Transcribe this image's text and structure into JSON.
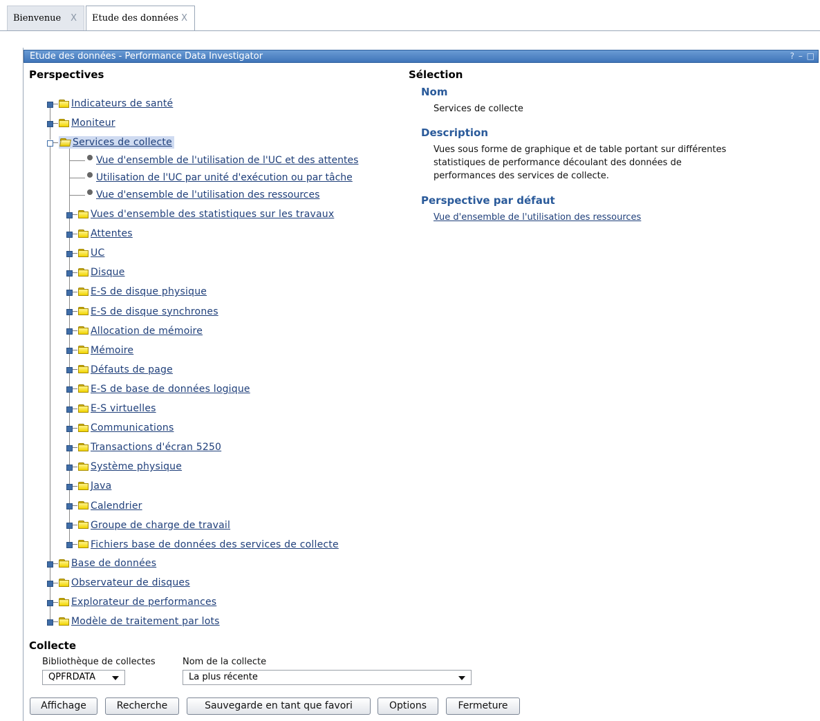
{
  "tabs": [
    {
      "label": "Bienvenue",
      "close": "X"
    },
    {
      "label": "Etude des données",
      "close": "X"
    }
  ],
  "panel": {
    "title": "Etude des données - Performance Data Investigator",
    "controls": "? – □"
  },
  "perspectives": {
    "heading": "Perspectives",
    "top_items": [
      "Indicateurs de santé",
      "Moniteur",
      "Services de collecte"
    ],
    "collection_views": [
      "Vue d'ensemble de l'utilisation de l'UC et des attentes",
      "Utilisation de l'UC par unité d'exécution ou par tâche",
      "Vue d'ensemble de l'utilisation des ressources"
    ],
    "collection_folders": [
      "Vues d'ensemble des statistiques sur les travaux",
      "Attentes",
      "UC",
      "Disque",
      "E-S de disque physique",
      "E-S de disque synchrones",
      "Allocation de mémoire",
      "Mémoire",
      "Défauts de page",
      "E-S de base de données logique",
      "E-S virtuelles",
      "Communications",
      "Transactions d'écran 5250",
      "Système physique",
      "Java",
      "Calendrier",
      "Groupe de charge de travail",
      "Fichiers base de données des services de collecte"
    ],
    "bottom_items": [
      "Base de données",
      "Observateur de disques",
      "Explorateur de performances",
      "Modèle de traitement par lots"
    ]
  },
  "selection": {
    "heading": "Sélection",
    "name_label": "Nom",
    "name_value": "Services de collecte",
    "description_label": "Description",
    "description_lines": [
      "Vues sous forme de graphique et de table portant sur différentes",
      "statistiques de performance découlant des données de",
      "performances des services de collecte."
    ],
    "default_label": "Perspective par défaut",
    "default_link": "Vue d'ensemble de l'utilisation des ressources"
  },
  "collecte": {
    "heading": "Collecte",
    "library_label": "Bibliothèque de collectes",
    "library_value": "QPFRDATA",
    "name_label": "Nom de la collecte",
    "name_value": "La plus récente"
  },
  "buttons": {
    "display": "Affichage",
    "search": "Recherche",
    "save_favorite": "Sauvegarde en tant que favori",
    "options": "Options",
    "close": "Fermeture"
  }
}
